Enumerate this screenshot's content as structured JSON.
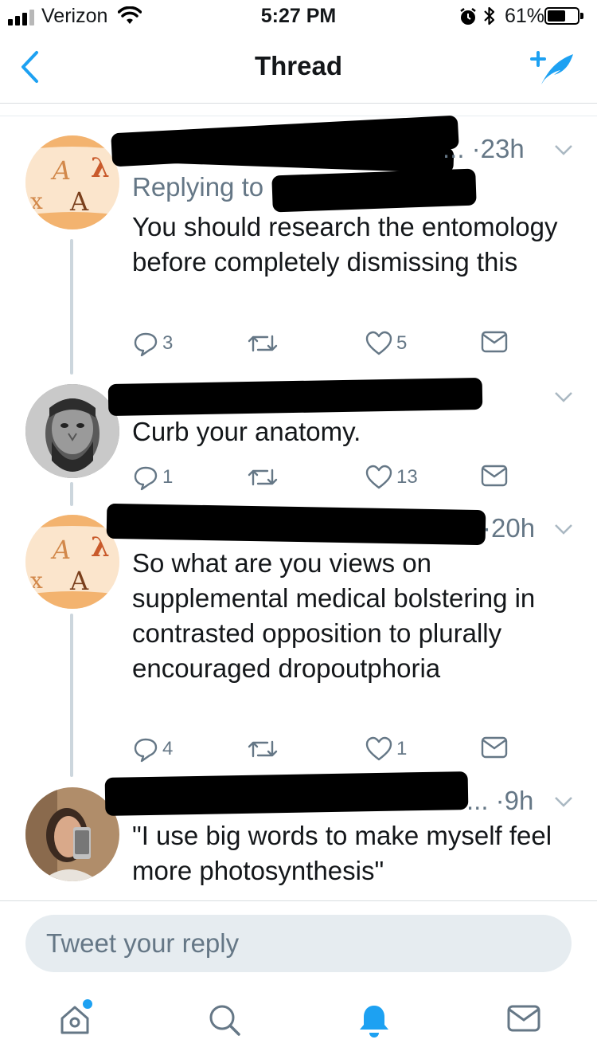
{
  "status_bar": {
    "carrier": "Verizon",
    "time": "5:27 PM",
    "battery_percent": "61%",
    "battery_level": 0.61
  },
  "nav": {
    "title": "Thread",
    "back_icon": "chevron-left-icon",
    "compose_icon": "compose-tweet-icon"
  },
  "accent_color": "#1da1f2",
  "tweets": [
    {
      "time_prefix": "... ·",
      "time": "23h",
      "replying_label": "Replying to",
      "text": "You should research the entomology before completely dismissing this",
      "replies": "3",
      "retweets": "",
      "likes": "5"
    },
    {
      "time_prefix": "",
      "time": "",
      "text": "Curb your anatomy.",
      "replies": "1",
      "retweets": "",
      "likes": "13"
    },
    {
      "time_prefix": "·",
      "time": "20h",
      "text": "So what are you views on supplemental medical bolstering in contrasted opposition to plurally encouraged dropoutphoria",
      "replies": "4",
      "retweets": "",
      "likes": "1"
    },
    {
      "time_prefix": "... ·",
      "time": "9h",
      "text": "\"I use big words to make myself feel more photosynthesis\""
    }
  ],
  "reply": {
    "placeholder": "Tweet your reply"
  },
  "tabbar": {
    "items": [
      "home-icon",
      "search-icon",
      "notifications-icon",
      "messages-icon"
    ],
    "active": "notifications-icon"
  }
}
